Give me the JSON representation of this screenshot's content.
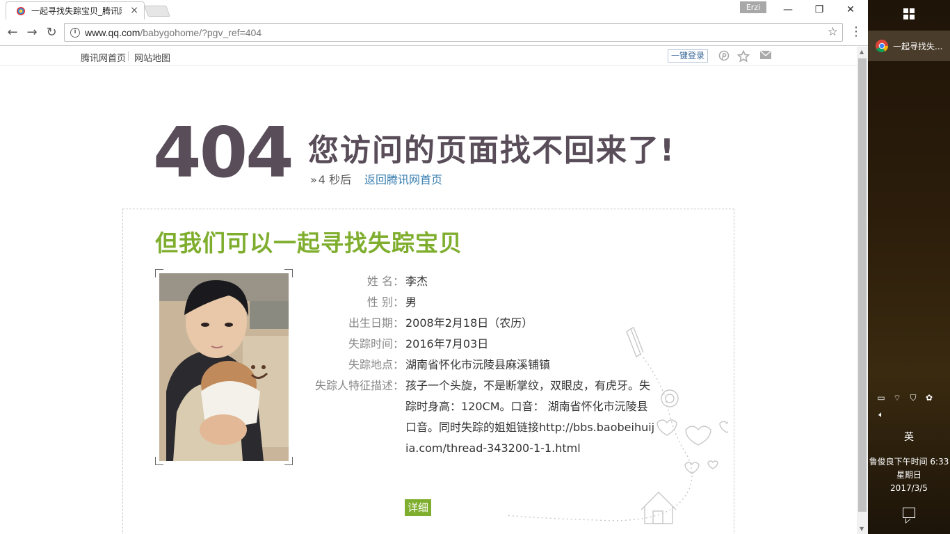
{
  "browser": {
    "tab_title": "一起寻找失踪宝贝_腾讯网",
    "tab_close": "×",
    "profile_name": "Erzi",
    "url_host": "www.qq.com",
    "url_path": "/babygohome/?pgv_ref=404",
    "win_minimize": "—",
    "win_restore": "❐",
    "win_close": "✕",
    "back": "←",
    "forward": "→",
    "reload": "↻",
    "star": "☆",
    "menu": "⋮"
  },
  "topbar": {
    "home_link": "腾讯网首页",
    "sitemap_link": "网站地图",
    "login_button": "一键登录",
    "icons": [
      "pinterest-icon",
      "star-icon",
      "mail-icon"
    ]
  },
  "error": {
    "code": "404",
    "headline": "您访问的页面找不回来了!",
    "countdown_arrow": "»",
    "countdown": "4 秒后",
    "home_link": "返回腾讯网首页"
  },
  "missing": {
    "title": "但我们可以一起寻找失踪宝贝",
    "fields": [
      {
        "label": "姓 名：",
        "value": "李杰"
      },
      {
        "label": "性 别：",
        "value": "男"
      },
      {
        "label": "出生日期：",
        "value": "2008年2月18日（农历）"
      },
      {
        "label": "失踪时间：",
        "value": "2016年7月03日"
      },
      {
        "label": "失踪地点：",
        "value": "湖南省怀化市沅陵县麻溪铺镇"
      },
      {
        "label": "失踪人特征描述：",
        "value": "孩子一个头旋，不是断掌纹，双眼皮，有虎牙。失踪时身高：120CM。口音： 湖南省怀化市沅陵县口音。同时失踪的姐姐链接http://bbs.baobeihuijia.com/thread-343200-1-1.html"
      }
    ],
    "detail_button": "详细"
  },
  "taskbar": {
    "app_label": "一起寻找失...",
    "ime": "英",
    "clock_line1": "鲁俊良下午时间 6:33",
    "clock_line2": "星期日",
    "clock_line3": "2017/3/5"
  },
  "colors": {
    "accent_green": "#7fae2e",
    "error_purple": "#584d59",
    "link_blue": "#3a7fb0"
  }
}
